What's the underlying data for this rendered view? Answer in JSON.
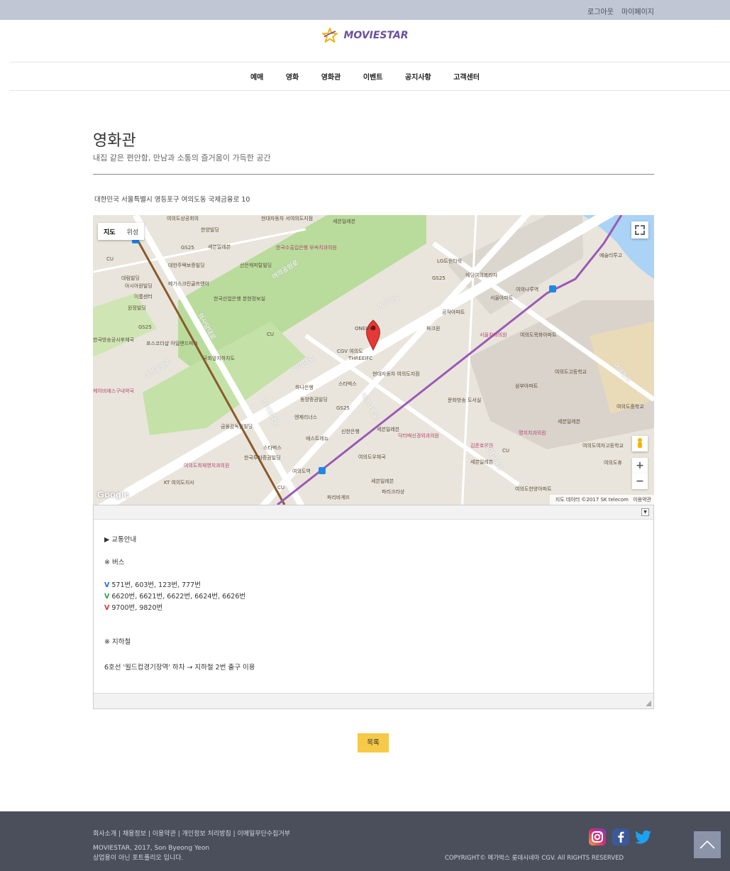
{
  "topbar": {
    "logout": "로그아웃",
    "mypage": "마이페이지"
  },
  "brand": {
    "name": "MOVIESTAR"
  },
  "nav": [
    "예매",
    "영화",
    "영화관",
    "이벤트",
    "공지사항",
    "고객센터"
  ],
  "page": {
    "title": "영화관",
    "subtitle": "내집 같은 편안함, 만남과 소통의 즐거움이 가득한 공간",
    "address": "대한민국 서울특별시 영등포구 여의도동 국제금융로 10"
  },
  "map": {
    "type_map": "지도",
    "type_satellite": "위성",
    "google": "Google",
    "attribution": "지도 데이터 ©2017 SK telecom",
    "terms": "이용약관",
    "zoom_in": "+",
    "zoom_out": "−",
    "colors": {
      "park": "#a9d48f",
      "road": "#ffffff",
      "water": "#aad3f5",
      "subway": "#9b59b6",
      "line9": "#8b5a2b",
      "marker": "#e53935"
    },
    "labels": {
      "l1": "여의도상공회의",
      "l2": "한양빌딩",
      "l3": "현대자동차 서여의도지점",
      "l4": "세븐일레븐",
      "l5": "GS25",
      "l6": "세븐일레븐",
      "l7": "한국수출입은행 부속치과의원",
      "l8": "CU",
      "l9": "대한주택보증빌딩",
      "l10": "산은캐피탈빌딩",
      "l11": "대림빌딩",
      "l12": "아시아원빌딩",
      "l13": "메가스크린골프앤이",
      "l14": "이룸센터",
      "l15": "원정빌딩",
      "l16": "한국산업은행 본현정보실",
      "l17": "한국방송공사후체국",
      "l18": "GS25",
      "l19": "포스코더샵 아일랜드파크",
      "l20": "CU",
      "l21": "국회앞지하차도",
      "l22": "케이비에스구내약국",
      "l23": "ONEIFC",
      "l24": "CGV 여의도",
      "l25": "THREEIFC",
      "l26": "파크원",
      "l27": "LG트윈타워",
      "l28": "GS25",
      "l29": "웨딩여의프라자",
      "l30": "여의나루역",
      "l31": "서울아파트",
      "l32": "공작아파트",
      "l33": "서울치과의원",
      "l34": "여의도목화아파트",
      "l35": "현대자동차 여의도지점",
      "l36": "하나은행",
      "l37": "스타벅스",
      "l38": "동양증권빌딩",
      "l39": "GS25",
      "l40": "엔제리너스",
      "l41": "금융감독원빌딩",
      "l42": "신한은행",
      "l43": "에스트레뉴",
      "l44": "세븐일레븐",
      "l45": "닥터배신경외과의원",
      "l46": "문화방송 도서실",
      "l47": "삼부아파트",
      "l48": "여의도고등학교",
      "l49": "여의도중학교",
      "l50": "명지치과의원",
      "l51": "여의도여자고등학교",
      "l52": "김준호의원",
      "l53": "CU",
      "l54": "세븐일레븐",
      "l55": "스타벅스",
      "l56": "한국투자증권빌딩",
      "l57": "여의도최재영치과의원",
      "l58": "여의도역",
      "l59": "여의도우체국",
      "l60": "KT 여의도지사",
      "l61": "CU",
      "l62": "세븐일레븐",
      "l63": "파리크라상",
      "l64": "파리바게뜨",
      "l65": "여의도한양아파트",
      "l66": "세븐일레븐",
      "l67": "여의도휴",
      "l68": "예슬리투고",
      "r1": "여의대로",
      "r2": "여의공원로",
      "r3": "의사당대로",
      "r4": "여의대로",
      "r5": "여의나루로",
      "r6": "국제금융로",
      "r7": "여의공원로",
      "r8": "의사당대로",
      "r9": "여의동로"
    }
  },
  "transit": {
    "heading": "▶ 교통안내",
    "bus_heading": "※ 버스",
    "bus_lines": [
      {
        "mark": "V",
        "color": "#1e6fd9",
        "text": "571번, 603번, 123번, 777번"
      },
      {
        "mark": "V",
        "color": "#2e9e3e",
        "text": "6620번, 6621번, 6622번, 6624번, 6626번"
      },
      {
        "mark": "V",
        "color": "#d9342b",
        "text": "9700번, 9820번"
      }
    ],
    "subway_heading": "※ 지하철",
    "subway_text": "6호선 '월드컵경기장역' 하차 → 지하철 2번 출구 이용"
  },
  "list_button": "목록",
  "footer": {
    "links": "회사소개 | 채용정보 | 이용약관 | 개인정보 처리방침 | 이메일무단수집거부",
    "credit1": "MOVIESTAR, 2017, Son Byeong Yeon",
    "credit2": "상업용이 아닌 포트폴리오 입니다.",
    "copyright": "COPYRIGHT© 메가박스 롯데시네마 CGV. All RIGHTS RESERVED"
  }
}
